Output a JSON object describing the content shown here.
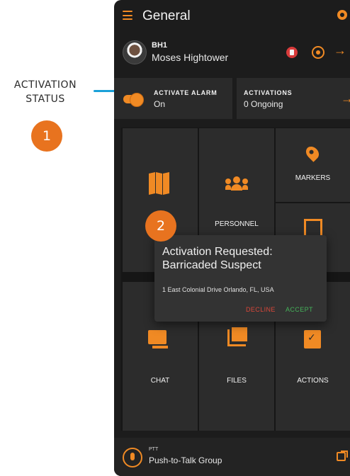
{
  "callouts": {
    "activation_status_label": "ACTIVATION STATUS",
    "badge_1": "1",
    "badge_2": "2"
  },
  "app": {
    "title": "General",
    "user": {
      "callsign": "BH1",
      "name": "Moses Hightower"
    },
    "activate_alarm": {
      "label": "ACTIVATE ALARM",
      "value": "On",
      "toggle_on": true
    },
    "activations": {
      "label": "ACTIVATIONS",
      "value": "0 Ongoing"
    },
    "tiles": {
      "markers": "MARKERS",
      "personnel": "PERSONNEL",
      "chat": "CHAT",
      "files": "FILES",
      "actions": "ACTIONS"
    },
    "dialog": {
      "title": "Activation Requested: Barricaded Suspect",
      "address": "1 East Colonial Drive Orlando, FL, USA",
      "decline": "DECLINE",
      "accept": "ACCEPT"
    },
    "ptt": {
      "label": "PTT",
      "group": "Push-to-Talk Group"
    }
  },
  "colors": {
    "accent": "#f08a24",
    "callout_badge": "#e8731f",
    "callout_line": "#1aa0d8",
    "decline": "#d9473a",
    "accept": "#45b35a",
    "background": "#1c1c1c"
  },
  "icons": [
    "menu-icon",
    "settings-icon",
    "status-icon",
    "target-icon",
    "arrow-right-icon",
    "map-icon",
    "people-icon",
    "marker-pin-icon",
    "frame-icon",
    "chat-icon",
    "files-icon",
    "clipboard-icon",
    "microphone-icon",
    "external-link-icon"
  ]
}
